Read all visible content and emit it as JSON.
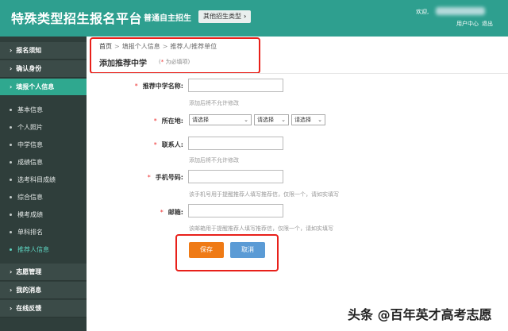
{
  "header": {
    "app_title": "特殊类型招生报名平台",
    "mode_label": "普通自主招生",
    "other_types_button": "其他招生类型",
    "welcome_text": "欢迎,",
    "user_center_link": "用户中心",
    "logout_link": "退出"
  },
  "sidebar": {
    "groups": [
      {
        "label": "报名须知"
      },
      {
        "label": "确认身份"
      },
      {
        "label": "填报个人信息"
      },
      {
        "label": "志愿管理"
      },
      {
        "label": "我的消息"
      },
      {
        "label": "在线反馈"
      }
    ],
    "sub_items": [
      {
        "label": "基本信息"
      },
      {
        "label": "个人照片"
      },
      {
        "label": "中学信息"
      },
      {
        "label": "成绩信息"
      },
      {
        "label": "选考科目成绩"
      },
      {
        "label": "综合信息"
      },
      {
        "label": "模考成绩"
      },
      {
        "label": "单科排名"
      },
      {
        "label": "推荐人信息"
      }
    ]
  },
  "breadcrumb": {
    "home": "首页",
    "level2": "填报个人信息",
    "level3": "推荐人/推荐单位"
  },
  "form": {
    "title": "添加推荐中学",
    "required_note_star": "*",
    "required_note_text": "为必填项",
    "school_name_label": "推荐中学名称:",
    "school_name_hint": "添加后将不允许修改",
    "location_label": "所在地:",
    "province_select": "请选择",
    "city_select": "请选择",
    "district_select": "请选择",
    "contact_label": "联系人:",
    "contact_hint": "添加后将不允许修改",
    "phone_label": "手机号码:",
    "phone_hint": "该手机号用于提醒推荐人填写推荐信，仅限一个，请如实填写",
    "email_label": "邮箱:",
    "email_hint": "该邮箱用于提醒推荐人填写推荐信，仅限一个，请如实填写",
    "save_button": "保存",
    "cancel_button": "取消"
  },
  "watermark": "头条 @百年英才高考志愿",
  "colors": {
    "header_bg": "#2e9f8f",
    "sidebar_bg": "#2f3e3b",
    "active_group": "#2fa88f",
    "save_button": "#ef7a15",
    "cancel_button": "#5b9bd5",
    "highlight_box": "#e8201a"
  }
}
